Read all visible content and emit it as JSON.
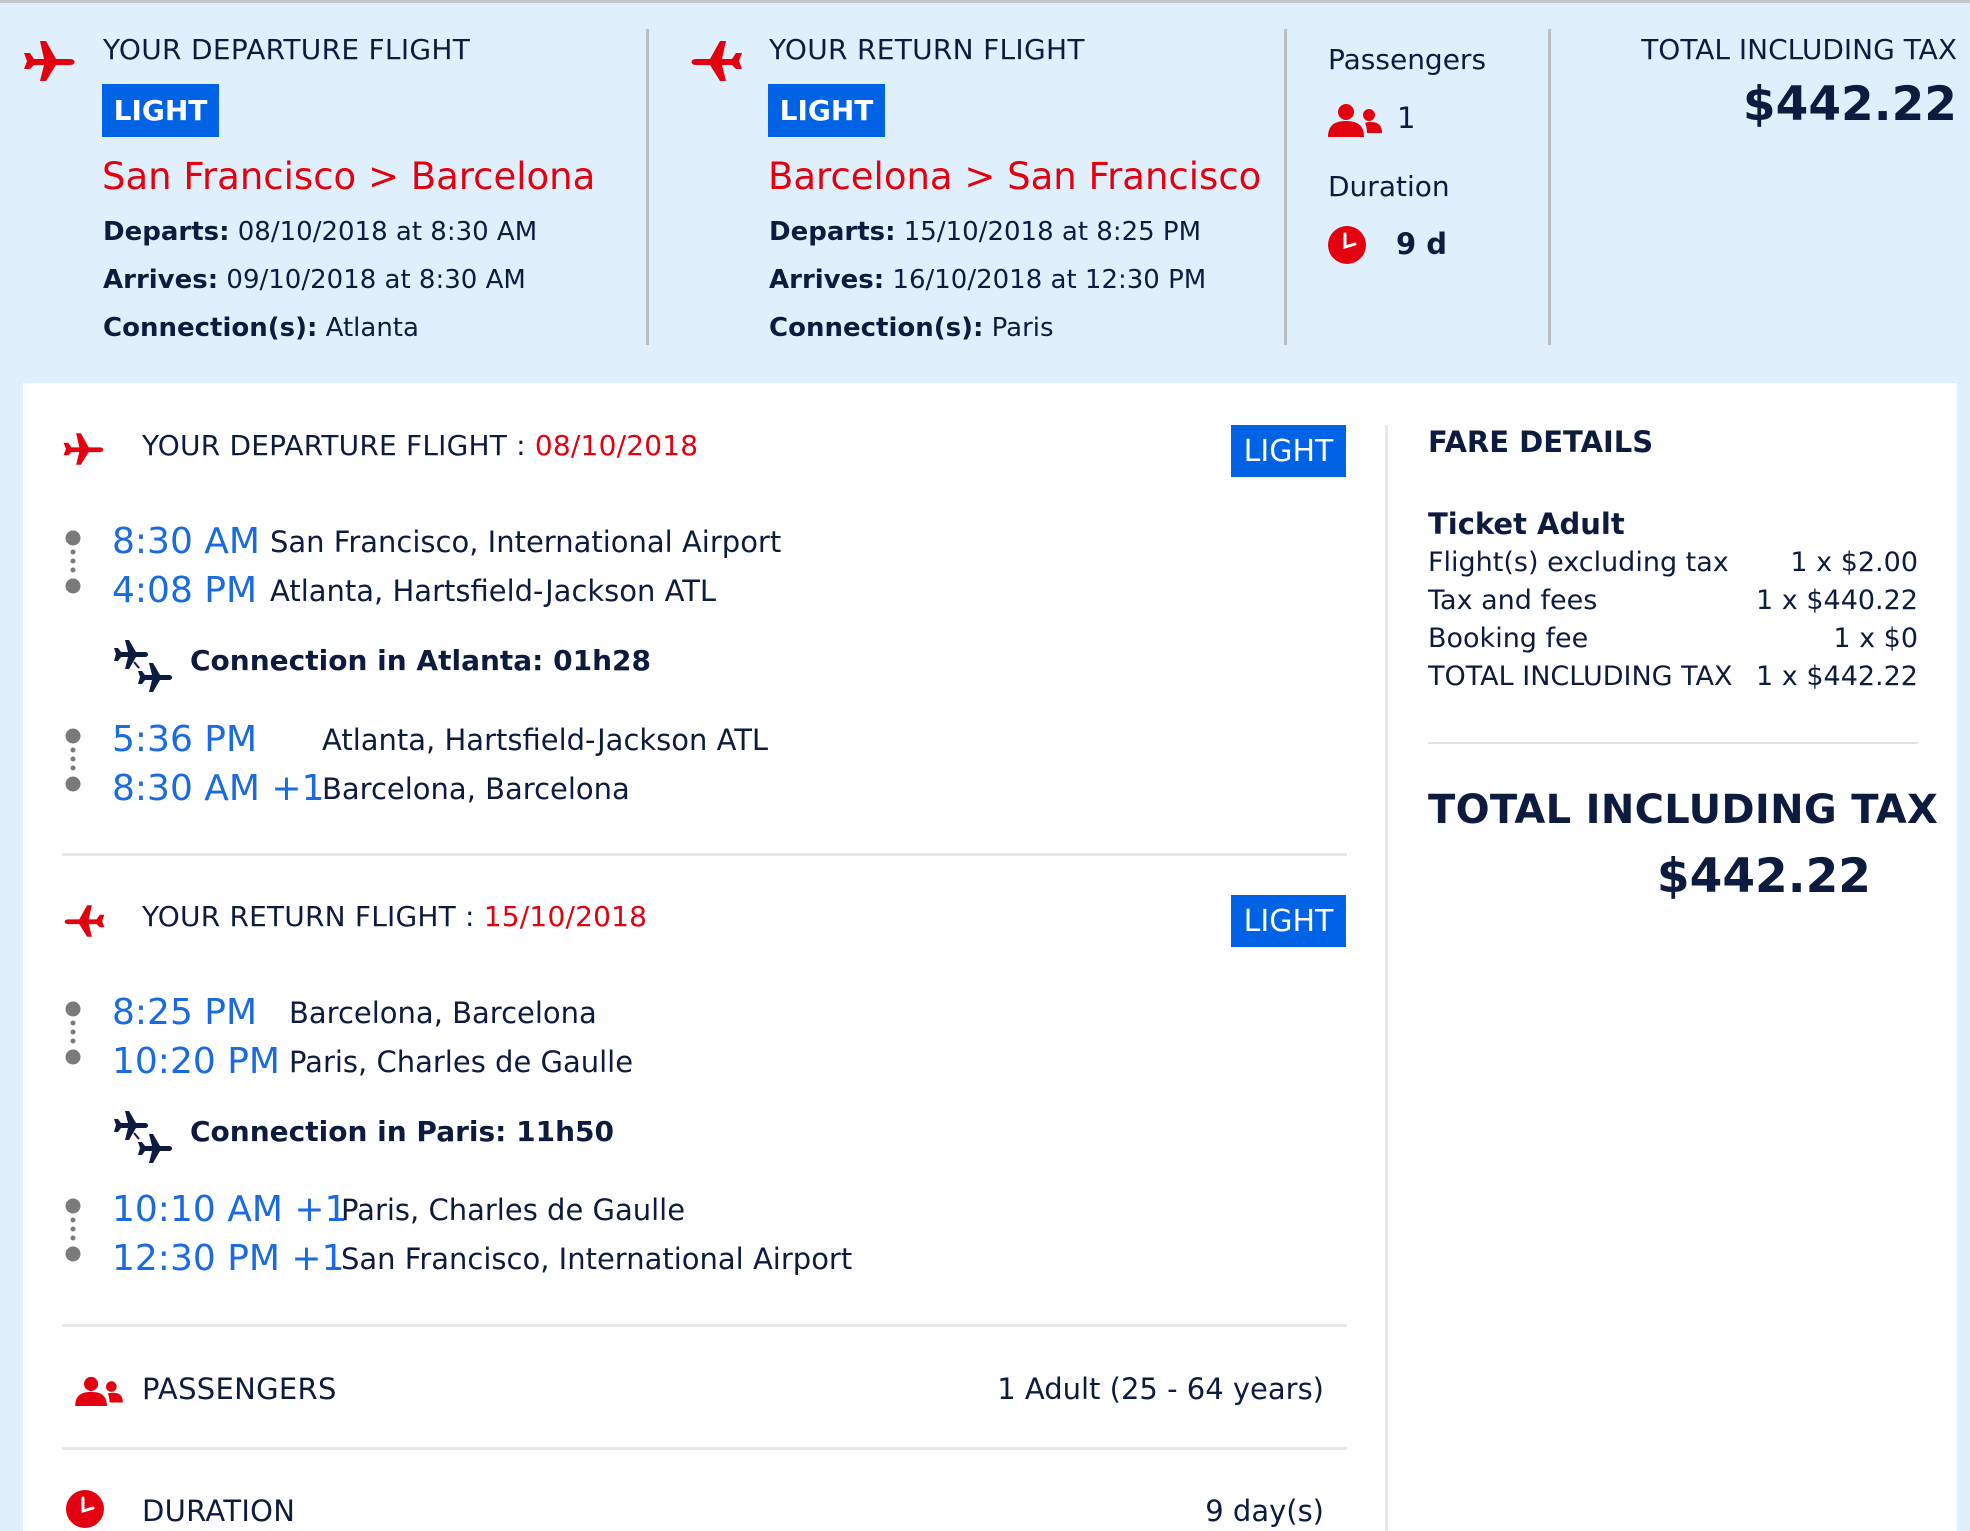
{
  "colors": {
    "accent_red": "#e3000f",
    "badge_blue": "#0063e5",
    "time_blue": "#1a6ae0",
    "text_navy": "#0d1b3e",
    "header_bg": "#dff0fc"
  },
  "summary": {
    "departure": {
      "icon": "plane-icon",
      "title": "YOUR DEPARTURE FLIGHT",
      "fare_class": "LIGHT",
      "route": "San Francisco > Barcelona",
      "departs_label": "Departs:",
      "departs_value": "08/10/2018 at 8:30 AM",
      "arrives_label": "Arrives:",
      "arrives_value": "09/10/2018 at 8:30 AM",
      "connections_label": "Connection(s):",
      "connections_value": "Atlanta"
    },
    "return": {
      "icon": "plane-icon",
      "title": "YOUR RETURN FLIGHT",
      "fare_class": "LIGHT",
      "route": "Barcelona > San Francisco",
      "departs_label": "Departs:",
      "departs_value": "15/10/2018 at 8:25 PM",
      "arrives_label": "Arrives:",
      "arrives_value": "16/10/2018 at 12:30 PM",
      "connections_label": "Connection(s):",
      "connections_value": "Paris"
    },
    "passengers_label": "Passengers",
    "passengers_icon": "people-icon",
    "passengers_value": "1",
    "duration_label": "Duration",
    "duration_icon": "clock-icon",
    "duration_value": "9 d",
    "total_label": "TOTAL INCLUDING TAX",
    "total_value": "$442.22"
  },
  "details": {
    "departure": {
      "title": "YOUR DEPARTURE FLIGHT : ",
      "date": "08/10/2018",
      "fare_class": "LIGHT",
      "legs": [
        {
          "from_time": "8:30 AM",
          "from_place": "San Francisco, International Airport",
          "to_time": "4:08 PM",
          "to_place": "Atlanta, Hartsfield-Jackson ATL"
        },
        {
          "from_time": "5:36 PM",
          "from_place": "Atlanta, Hartsfield-Jackson ATL",
          "to_time": "8:30 AM +1",
          "to_place": "Barcelona, Barcelona"
        }
      ],
      "connection": "Connection in Atlanta: 01h28"
    },
    "return": {
      "title": "YOUR RETURN FLIGHT : ",
      "date": "15/10/2018",
      "fare_class": "LIGHT",
      "legs": [
        {
          "from_time": "8:25 PM",
          "from_place": "Barcelona, Barcelona",
          "to_time": "10:20 PM",
          "to_place": "Paris, Charles de Gaulle"
        },
        {
          "from_time": "10:10 AM +1",
          "from_place": "Paris, Charles de Gaulle",
          "to_time": "12:30 PM +1",
          "to_place": "San Francisco, International Airport"
        }
      ],
      "connection": "Connection in Paris: 11h50"
    },
    "passengers_label": "PASSENGERS",
    "passengers_value": "1 Adult (25 - 64 years)",
    "duration_label": "DURATION",
    "duration_value": "9 day(s)"
  },
  "fare_details": {
    "title": "FARE DETAILS",
    "ticket_type": "Ticket Adult",
    "rows": [
      {
        "label": "Flight(s) excluding tax",
        "value": "1 x $2.00"
      },
      {
        "label": "Tax and fees",
        "value": "1 x $440.22"
      },
      {
        "label": "Booking fee",
        "value": "1 x $0"
      },
      {
        "label": "TOTAL INCLUDING TAX",
        "value": "1 x $442.22"
      }
    ],
    "total_label": "TOTAL INCLUDING TAX",
    "total_value": "$442.22"
  }
}
